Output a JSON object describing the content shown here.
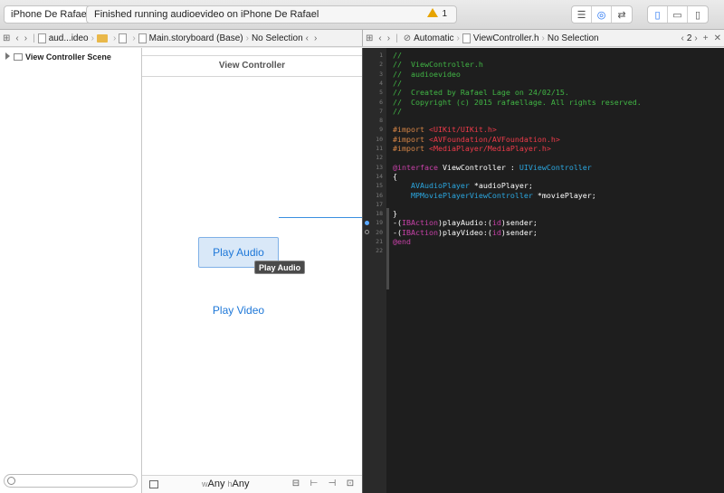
{
  "toolbar": {
    "scheme_device": "iPhone De Rafael",
    "activity_text": "Finished running audioevideo on iPhone De Rafael",
    "warning_count": "1",
    "editor_modes": [
      "standard-editor-icon",
      "assistant-editor-icon",
      "version-editor-icon"
    ],
    "view_toggles": [
      "navigator-toggle-icon",
      "debug-area-toggle-icon",
      "utilities-toggle-icon"
    ]
  },
  "left_jumpbar": {
    "items": [
      "aud...ideo",
      "Main.storyboard (Base)",
      "No Selection"
    ]
  },
  "right_jumpbar": {
    "items": [
      "Automatic",
      "ViewController.h",
      "No Selection"
    ],
    "counter": "2"
  },
  "outline": {
    "scene_label": "View Controller Scene"
  },
  "canvas": {
    "title": "View Controller",
    "play_audio_label": "Play Audio",
    "play_video_label": "Play Video",
    "tooltip": "Play Audio",
    "size_w_prefix": "w",
    "size_w": "Any",
    "size_h_prefix": "h",
    "size_h": "Any"
  },
  "code_lines": [
    {
      "n": "1",
      "tokens": [
        {
          "t": "//",
          "c": "comment"
        }
      ]
    },
    {
      "n": "2",
      "tokens": [
        {
          "t": "//  ViewController.h",
          "c": "comment"
        }
      ]
    },
    {
      "n": "3",
      "tokens": [
        {
          "t": "//  audioevideo",
          "c": "comment"
        }
      ]
    },
    {
      "n": "4",
      "tokens": [
        {
          "t": "//",
          "c": "comment"
        }
      ]
    },
    {
      "n": "5",
      "tokens": [
        {
          "t": "//  Created by Rafael Lage on 24/02/15.",
          "c": "comment"
        }
      ]
    },
    {
      "n": "6",
      "tokens": [
        {
          "t": "//  Copyright (c) 2015 rafaellage. All rights reserved.",
          "c": "comment"
        }
      ]
    },
    {
      "n": "7",
      "tokens": [
        {
          "t": "//",
          "c": "comment"
        }
      ]
    },
    {
      "n": "8",
      "tokens": []
    },
    {
      "n": "9",
      "tokens": [
        {
          "t": "#import ",
          "c": "pre"
        },
        {
          "t": "<UIKit/UIKit.h>",
          "c": "str"
        }
      ]
    },
    {
      "n": "10",
      "tokens": [
        {
          "t": "#import ",
          "c": "pre"
        },
        {
          "t": "<AVFoundation/AVFoundation.h>",
          "c": "str"
        }
      ]
    },
    {
      "n": "11",
      "tokens": [
        {
          "t": "#import ",
          "c": "pre"
        },
        {
          "t": "<MediaPlayer/MediaPlayer.h>",
          "c": "str"
        }
      ]
    },
    {
      "n": "12",
      "tokens": []
    },
    {
      "n": "13",
      "tokens": [
        {
          "t": "@interface",
          "c": "kw"
        },
        {
          "t": " ViewController : ",
          "c": "plain"
        },
        {
          "t": "UIViewController",
          "c": "type"
        }
      ]
    },
    {
      "n": "14",
      "tokens": [
        {
          "t": "{",
          "c": "plain"
        }
      ]
    },
    {
      "n": "15",
      "tokens": [
        {
          "t": "    ",
          "c": "plain"
        },
        {
          "t": "AVAudioPlayer",
          "c": "type"
        },
        {
          "t": " *audioPlayer;",
          "c": "plain"
        }
      ]
    },
    {
      "n": "16",
      "tokens": [
        {
          "t": "    ",
          "c": "plain"
        },
        {
          "t": "MPMoviePlayerViewController",
          "c": "type"
        },
        {
          "t": " *moviePlayer;",
          "c": "plain"
        }
      ]
    },
    {
      "n": "17",
      "tokens": []
    },
    {
      "n": "18",
      "tokens": [
        {
          "t": "}",
          "c": "plain"
        }
      ]
    },
    {
      "n": "19",
      "marker": "filled",
      "tokens": [
        {
          "t": "-(",
          "c": "plain"
        },
        {
          "t": "IBAction",
          "c": "kw"
        },
        {
          "t": ")playAudio:(",
          "c": "plain"
        },
        {
          "t": "id",
          "c": "kw"
        },
        {
          "t": ")sender;",
          "c": "plain"
        }
      ]
    },
    {
      "n": "20",
      "marker": "empty",
      "tokens": [
        {
          "t": "-(",
          "c": "plain"
        },
        {
          "t": "IBAction",
          "c": "kw"
        },
        {
          "t": ")playVideo:(",
          "c": "plain"
        },
        {
          "t": "id",
          "c": "kw"
        },
        {
          "t": ")sender;",
          "c": "plain"
        }
      ]
    },
    {
      "n": "21",
      "tokens": [
        {
          "t": "@end",
          "c": "kw"
        }
      ]
    },
    {
      "n": "22",
      "tokens": []
    }
  ]
}
